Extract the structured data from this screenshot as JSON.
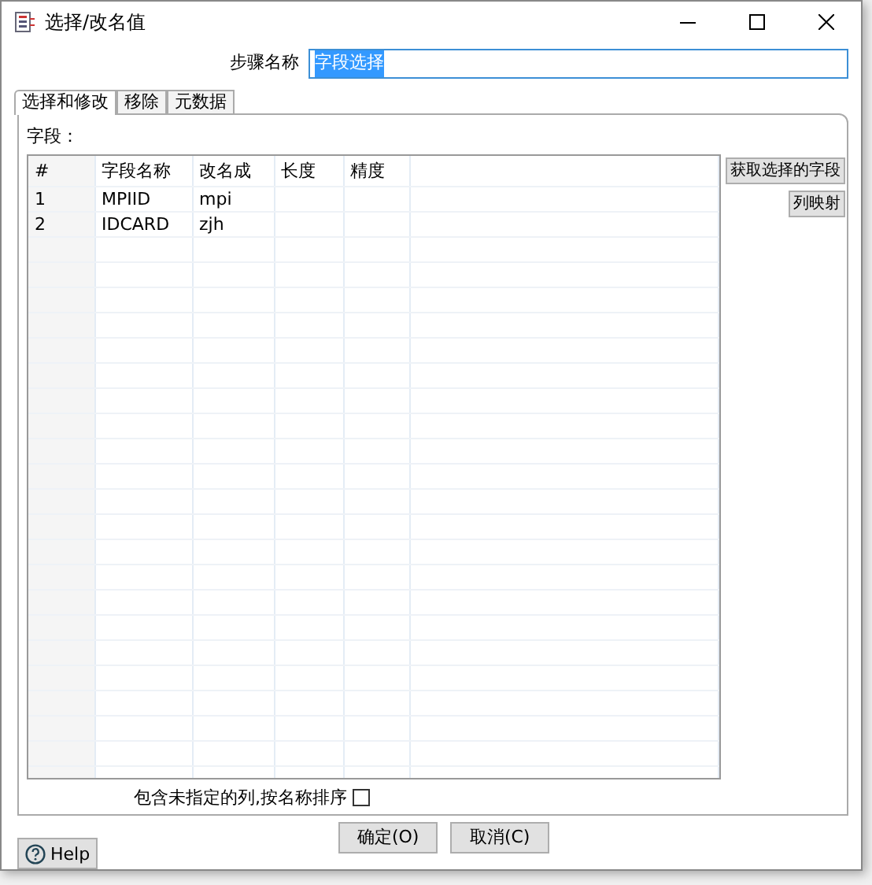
{
  "window": {
    "title": "选择/改名值"
  },
  "step_name": {
    "label": "步骤名称",
    "value": "字段选择",
    "text_selected": true
  },
  "tabs": [
    {
      "label": "选择和修改",
      "selected": true
    },
    {
      "label": "移除",
      "selected": false
    },
    {
      "label": "元数据",
      "selected": false
    }
  ],
  "fields_label": "字段：",
  "table": {
    "columns": [
      "#",
      "字段名称",
      "改名成",
      "长度",
      "精度"
    ],
    "rows": [
      [
        "1",
        "MPIID",
        "mpi",
        "",
        ""
      ],
      [
        "2",
        "IDCARD",
        "zjh",
        "",
        ""
      ]
    ]
  },
  "side_buttons": [
    "获取选择的字段",
    "列映射"
  ],
  "include_unspecified": {
    "label": "包含未指定的列,按名称排序",
    "checked": false
  },
  "buttons": [
    "确定(O)",
    "取消(C)"
  ],
  "help": "Help"
}
